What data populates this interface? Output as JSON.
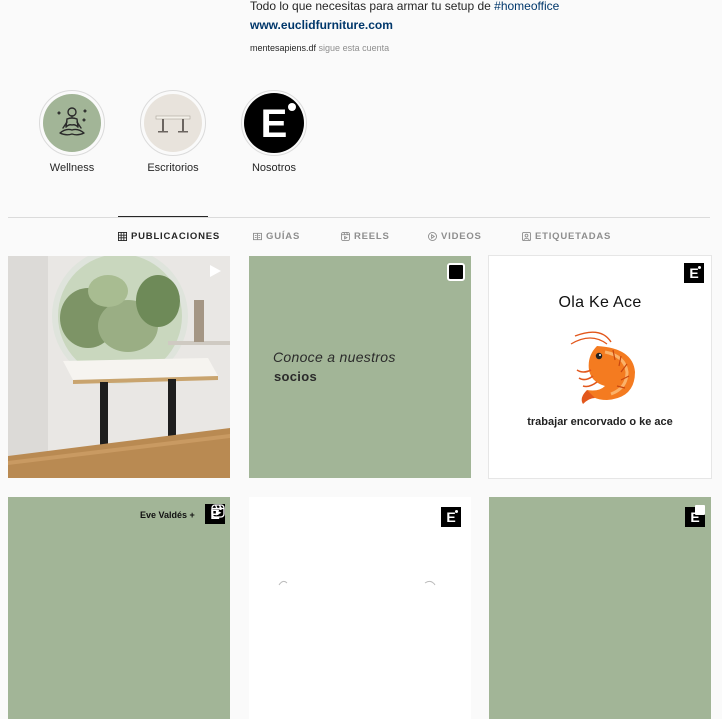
{
  "profile": {
    "bio_line": "Todo lo que necesitas para armar tu setup de ",
    "bio_hashtag": "#homeoffice",
    "website": "www.euclidfurniture.com",
    "followed_by_user": "mentesapiens.df",
    "followed_by_suffix": " sigue esta cuenta"
  },
  "highlights": [
    {
      "label": "Wellness",
      "icon": "meditation-icon"
    },
    {
      "label": "Escritorios",
      "icon": "desk-icon"
    },
    {
      "label": "Nosotros",
      "icon": "euclid-logo-icon"
    }
  ],
  "tabs": [
    {
      "label": "PUBLICACIONES",
      "icon": "grid-icon",
      "active": true
    },
    {
      "label": "GUÍAS",
      "icon": "guides-icon",
      "active": false
    },
    {
      "label": "REELS",
      "icon": "reels-icon",
      "active": false
    },
    {
      "label": "VIDEOS",
      "icon": "play-circle-icon",
      "active": false
    },
    {
      "label": "ETIQUETADAS",
      "icon": "tagged-icon",
      "active": false
    }
  ],
  "posts": [
    {
      "type": "video",
      "icon": "play-icon"
    },
    {
      "type": "carousel",
      "text_italic": "Conoce a nuestros",
      "text_bold": "socios",
      "bg": "#a2b597"
    },
    {
      "type": "image",
      "title": "Ola Ke Ace",
      "caption": "trabajar encorvado o ke ace"
    },
    {
      "type": "reel",
      "overlay_text": "Eve Valdés +",
      "bg": "#a2b597"
    },
    {
      "type": "image",
      "bg": "#ffffff"
    },
    {
      "type": "carousel",
      "bg": "#a2b597"
    }
  ],
  "colors": {
    "sage": "#a2b597",
    "link": "#00376b",
    "muted": "#8e8e8e"
  }
}
